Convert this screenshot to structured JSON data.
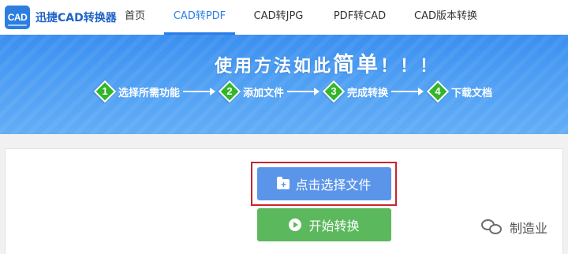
{
  "app": {
    "logo_badge": "CAD",
    "name": "迅捷CAD转换器"
  },
  "nav": {
    "items": [
      {
        "label": "首页",
        "active": false
      },
      {
        "label": "CAD转PDF",
        "active": true
      },
      {
        "label": "CAD转JPG",
        "active": false
      },
      {
        "label": "PDF转CAD",
        "active": false
      },
      {
        "label": "CAD版本转换",
        "active": false
      }
    ]
  },
  "banner": {
    "headline_prefix": "使用方法如此",
    "headline_emphasis": "简单",
    "headline_suffix": "！！！",
    "steps": [
      {
        "number": "1",
        "label": "选择所需功能"
      },
      {
        "number": "2",
        "label": "添加文件"
      },
      {
        "number": "3",
        "label": "完成转换"
      },
      {
        "number": "4",
        "label": "下载文档"
      }
    ]
  },
  "main": {
    "select_button_label": "点击选择文件",
    "start_button_label": "开始转换"
  },
  "watermark": {
    "text": "制造业"
  },
  "colors": {
    "brand": "#2d7ee0",
    "nav_active": "#2b7ee6",
    "banner": "#4c9df3",
    "step_marker": "#33b52a",
    "select_button": "#5b95ea",
    "start_button": "#5cb85c",
    "highlight_frame": "#c8252c"
  }
}
